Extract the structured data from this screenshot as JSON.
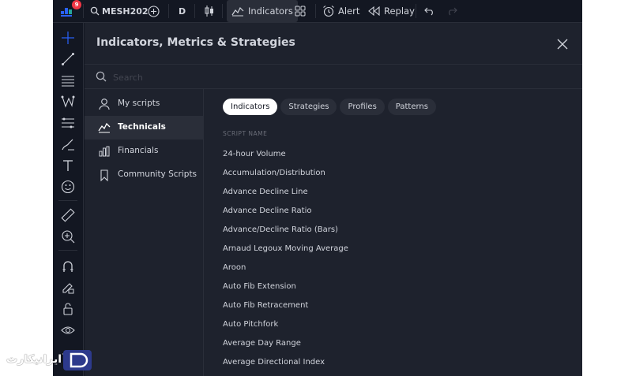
{
  "topbar": {
    "notification_count": "9",
    "symbol": "MESH202",
    "interval": "D",
    "indicators_label": "Indicators",
    "alert_label": "Alert",
    "replay_label": "Replay"
  },
  "dialog": {
    "title": "Indicators, Metrics & Strategies",
    "search_placeholder": "Search"
  },
  "sidebar": {
    "items": [
      {
        "label": "My scripts",
        "icon": "user-icon"
      },
      {
        "label": "Technicals",
        "icon": "chart-line-icon"
      },
      {
        "label": "Financials",
        "icon": "bar-chart-icon"
      },
      {
        "label": "Community Scripts",
        "icon": "bookmark-icon"
      }
    ]
  },
  "tabs": [
    "Indicators",
    "Strategies",
    "Profiles",
    "Patterns"
  ],
  "list": {
    "header": "SCRIPT NAME",
    "items": [
      "24-hour Volume",
      "Accumulation/Distribution",
      "Advance Decline Line",
      "Advance Decline Ratio",
      "Advance/Decline Ratio (Bars)",
      "Arnaud Legoux Moving Average",
      "Aroon",
      "Auto Fib Extension",
      "Auto Fib Retracement",
      "Auto Pitchfork",
      "Average Day Range",
      "Average Directional Index"
    ]
  },
  "watermark": {
    "text": "ایرانیکارت"
  },
  "colors": {
    "background": "#131722",
    "panel": "#1e222d",
    "accent": "#2962ff",
    "badge": "#f23645"
  }
}
